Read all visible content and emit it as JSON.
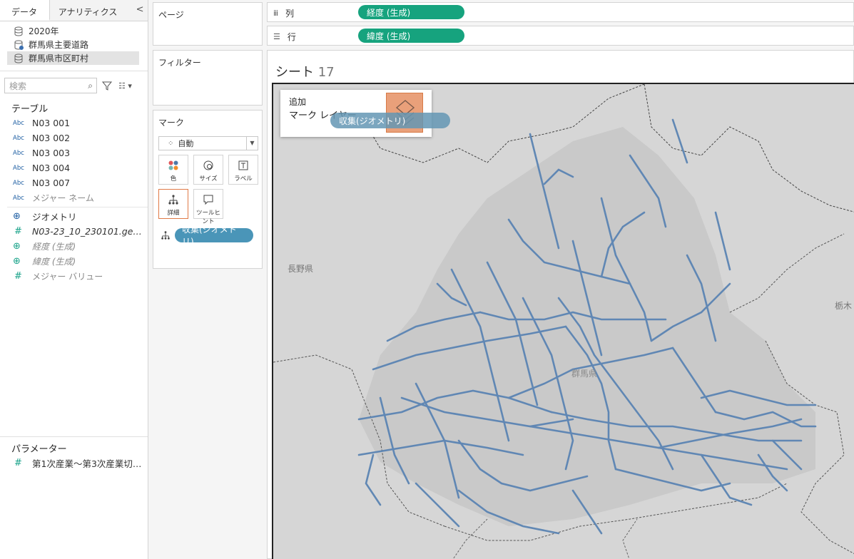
{
  "data_pane": {
    "tab_data": "データ",
    "tab_analytics": "アナリティクス",
    "collapse": "<",
    "datasources": [
      "2020年",
      "群馬県主要道路",
      "群馬県市区町村"
    ],
    "search_placeholder": "検索",
    "tables_title": "テーブル",
    "fields": [
      {
        "type": "Abc",
        "name": "N03 001"
      },
      {
        "type": "Abc",
        "name": "N03 002"
      },
      {
        "type": "Abc",
        "name": "N03 003"
      },
      {
        "type": "Abc",
        "name": "N03 004"
      },
      {
        "type": "Abc",
        "name": "N03 007"
      },
      {
        "type": "Abc",
        "name": "メジャー ネーム"
      },
      {
        "type": "geo",
        "name": "ジオメトリ"
      },
      {
        "type": "#",
        "name": "N03-23_10_230101.ge…"
      },
      {
        "type": "geo",
        "name": "経度 (生成)"
      },
      {
        "type": "geo",
        "name": "緯度 (生成)"
      },
      {
        "type": "#",
        "name": "メジャー バリュー"
      }
    ],
    "params_title": "パラメーター",
    "params": [
      {
        "type": "#",
        "name": "第1次産業〜第3次産業切…"
      }
    ]
  },
  "shelves": {
    "pages": "ページ",
    "filters": "フィルター",
    "marks": "マーク",
    "mark_type": "自動",
    "cards": {
      "color": "色",
      "size": "サイズ",
      "label": "ラベル",
      "detail": "詳細",
      "tooltip": "ツールヒント"
    },
    "detail_pill": "収集(ジオメトリ)",
    "columns_label": "列",
    "columns_pill": "経度 (生成)",
    "rows_label": "行",
    "rows_pill": "緯度 (生成)"
  },
  "sheet": {
    "title": "シート",
    "number": "17",
    "layer_add": "追加",
    "layer_marks": "マーク レイヤー",
    "drag_pill": "収集(ジオメトリ)",
    "map_labels": {
      "nagano": "長野県",
      "tochigi": "栃木",
      "gunma": "群馬県"
    }
  },
  "colors": {
    "green_pill": "#16a37e",
    "blue_pill": "#4a95b8",
    "road": "#5b84b3",
    "drop_zone": "#e9a07a"
  }
}
